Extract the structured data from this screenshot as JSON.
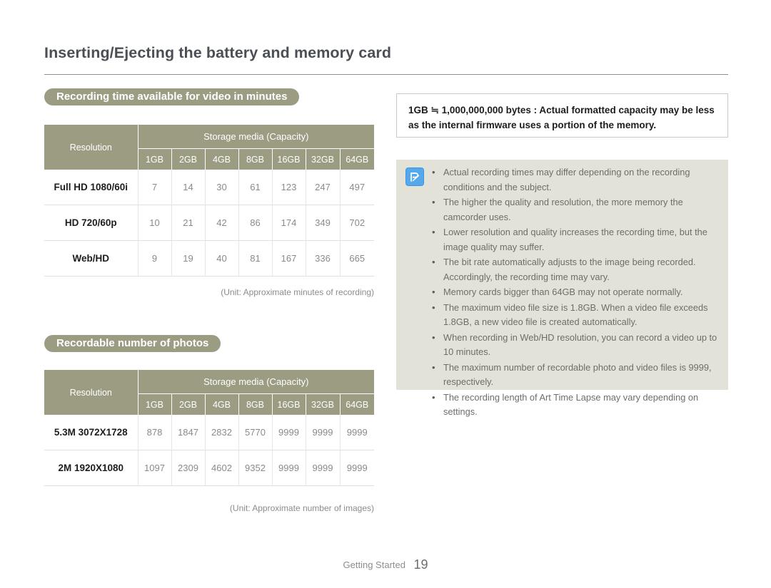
{
  "document": {
    "title": "Inserting/Ejecting the battery and memory card"
  },
  "sections": {
    "video": {
      "badge": "Recording time available for video in minutes",
      "unit_note": "(Unit: Approximate minutes of recording)"
    },
    "photos": {
      "badge": "Recordable number of photos",
      "unit_note": "(Unit: Approximate number of images)"
    }
  },
  "table_video": {
    "resolution_header": "Resolution",
    "group_header": "Storage media (Capacity)",
    "capacities": [
      "1GB",
      "2GB",
      "4GB",
      "8GB",
      "16GB",
      "32GB",
      "64GB"
    ],
    "rows": [
      {
        "resolution": "Full HD 1080/60i",
        "values": [
          "7",
          "14",
          "30",
          "61",
          "123",
          "247",
          "497"
        ]
      },
      {
        "resolution": "HD 720/60p",
        "values": [
          "10",
          "21",
          "42",
          "86",
          "174",
          "349",
          "702"
        ]
      },
      {
        "resolution": "Web/HD",
        "values": [
          "9",
          "19",
          "40",
          "81",
          "167",
          "336",
          "665"
        ]
      }
    ]
  },
  "table_photo": {
    "resolution_header": "Resolution",
    "group_header": "Storage media (Capacity)",
    "capacities": [
      "1GB",
      "2GB",
      "4GB",
      "8GB",
      "16GB",
      "32GB",
      "64GB"
    ],
    "rows": [
      {
        "resolution": "5.3M 3072X1728",
        "values": [
          "878",
          "1847",
          "2832",
          "5770",
          "9999",
          "9999",
          "9999"
        ]
      },
      {
        "resolution": "2M 1920X1080",
        "values": [
          "1097",
          "2309",
          "4602",
          "9352",
          "9999",
          "9999",
          "9999"
        ]
      }
    ]
  },
  "capacity_box": {
    "line1": "1GB ≒ 1,000,000,000 bytes : Actual formatted capacity may be less",
    "line2": "as the internal firmware uses a portion of the memory."
  },
  "notes": {
    "icon": "note-pen-icon",
    "items": [
      "Actual recording times may differ depending on the recording conditions and the subject.",
      "The higher the quality and resolution, the more memory the camcorder uses.",
      "Lower resolution and quality increases the recording time, but the image quality may suffer.",
      "The bit rate automatically adjusts to the image being recorded. Accordingly, the recording time may vary.",
      "Memory cards bigger than 64GB may not operate normally.",
      "The maximum video file size is 1.8GB. When a video file exceeds 1.8GB, a new video file is created automatically.",
      "When recording in Web/HD resolution, you can record a video up to 10 minutes.",
      "The maximum number of recordable photo and video files is 9999, respectively.",
      "The recording length of Art Time Lapse may vary depending on settings."
    ]
  },
  "footer": {
    "label": "Getting Started",
    "page_number": "19"
  },
  "colors": {
    "table_header": "#9c9c83",
    "badge": "#9c9c83",
    "notes_panel": "#e2e2d8",
    "note_icon": "#54a8ec"
  }
}
